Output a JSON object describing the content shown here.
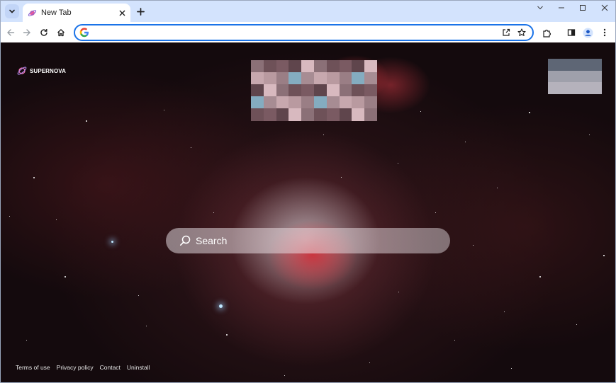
{
  "browser": {
    "tab": {
      "title": "New Tab",
      "favicon": "supernova-planet-icon"
    },
    "tab_search_icon": "chevron-down-icon",
    "new_tab_icon": "plus-icon",
    "window_controls": [
      "chevron-down-icon",
      "minimize-icon",
      "maximize-icon",
      "close-icon"
    ],
    "toolbar": {
      "back_icon": "arrow-left-icon",
      "forward_icon": "arrow-right-icon",
      "reload_icon": "reload-icon",
      "home_icon": "home-icon",
      "omnibox": {
        "value": "",
        "placeholder": "",
        "engine_icon": "google-g-icon"
      },
      "share_icon": "share-icon",
      "bookmark_icon": "star-icon",
      "extensions_icon": "puzzle-icon",
      "side_panel_icon": "side-panel-icon",
      "profile_icon": "profile-icon",
      "menu_icon": "kebab-menu-icon"
    },
    "accent_color": "#1a73e8",
    "tabstrip_color": "#d3e3fd"
  },
  "page": {
    "brand": {
      "name": "SUPERNOVA",
      "logo": "planet-ring-icon"
    },
    "search": {
      "placeholder": "Search",
      "icon": "search-icon"
    },
    "footer": {
      "links": [
        "Terms of use",
        "Privacy policy",
        "Contact",
        "Uninstall"
      ]
    },
    "background": "Orion nebula starfield"
  }
}
